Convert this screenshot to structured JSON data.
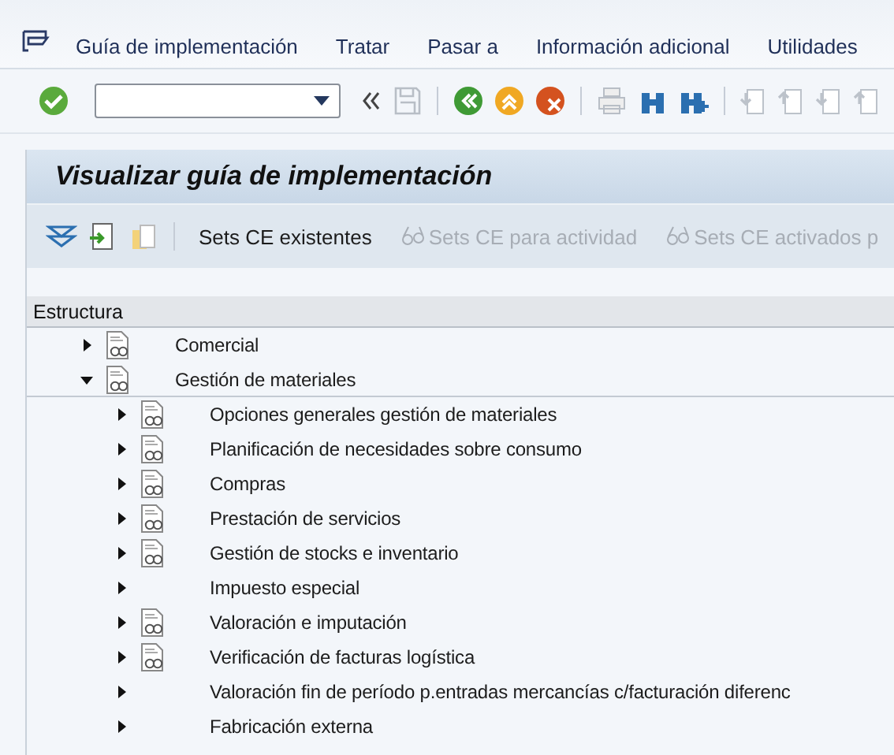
{
  "menu": [
    "Guía de implementación",
    "Tratar",
    "Pasar a",
    "Información adicional",
    "Utilidades"
  ],
  "title": "Visualizar guía de implementación",
  "app_toolbar": [
    {
      "label": "Sets CE existentes",
      "disabled": false
    },
    {
      "label": "Sets CE para actividad",
      "disabled": true
    },
    {
      "label": "Sets CE activados p",
      "disabled": true
    }
  ],
  "tree": {
    "header": "Estructura",
    "nodes": [
      {
        "label": "Comercial",
        "expanded": false,
        "documented": true
      },
      {
        "label": "Gestión de materiales",
        "expanded": true,
        "documented": true,
        "children": [
          {
            "label": "Opciones generales gestión de materiales",
            "expanded": false,
            "documented": true
          },
          {
            "label": "Planificación de necesidades sobre consumo",
            "expanded": false,
            "documented": true
          },
          {
            "label": "Compras",
            "expanded": false,
            "documented": true
          },
          {
            "label": "Prestación de servicios",
            "expanded": false,
            "documented": true
          },
          {
            "label": "Gestión de stocks e inventario",
            "expanded": false,
            "documented": true
          },
          {
            "label": "Impuesto especial",
            "expanded": false,
            "documented": false
          },
          {
            "label": "Valoración e imputación",
            "expanded": false,
            "documented": true
          },
          {
            "label": "Verificación de facturas logística",
            "expanded": false,
            "documented": true
          },
          {
            "label": "Valoración fin de período p.entradas mercancías c/facturación diferenc",
            "expanded": false,
            "documented": false
          },
          {
            "label": "Fabricación externa",
            "expanded": false,
            "documented": false
          }
        ]
      }
    ]
  }
}
